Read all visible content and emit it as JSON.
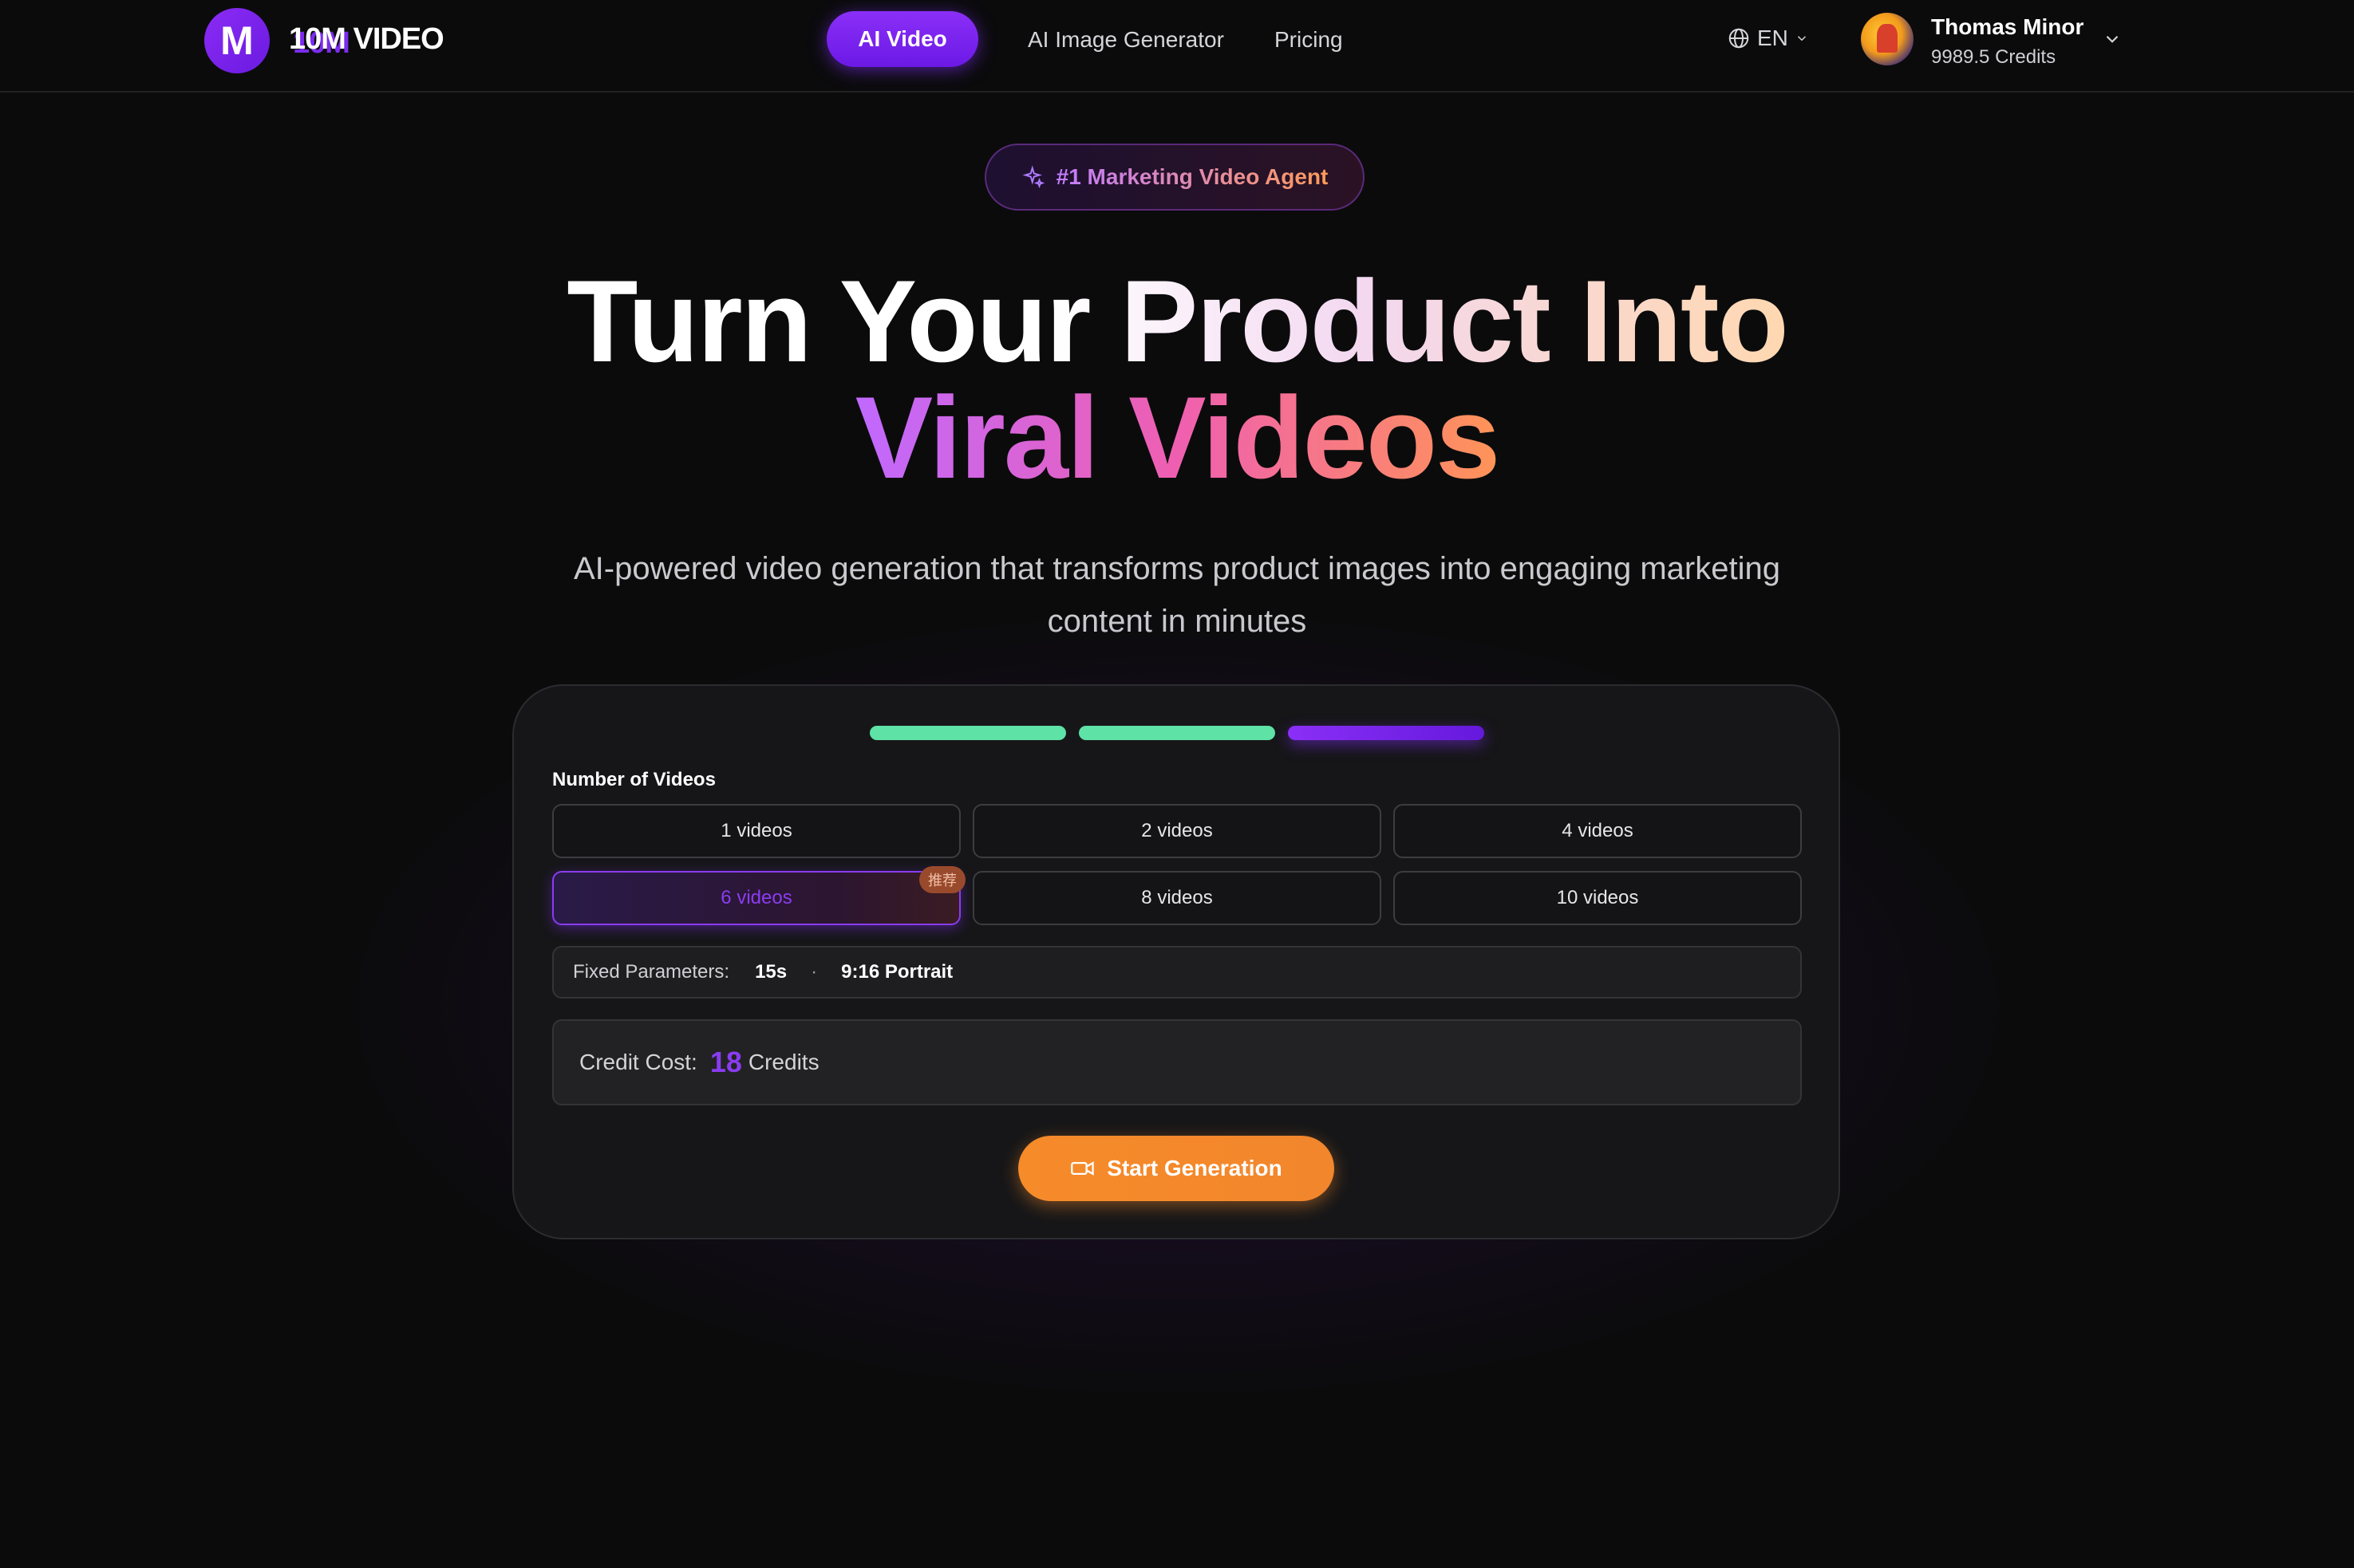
{
  "header": {
    "logo_letter": "M",
    "logo_text_accent": "10M",
    "logo_text_main": " VIDEO",
    "nav": {
      "ai_video": "AI Video",
      "ai_image_generator": "AI Image Generator",
      "pricing": "Pricing"
    },
    "language": "EN",
    "user": {
      "name": "Thomas Minor",
      "credits": "9989.5 Credits"
    }
  },
  "hero": {
    "badge": "#1 Marketing Video Agent",
    "title_line1": "Turn Your Product Into",
    "title_line2": "Viral Videos",
    "subtitle": "AI-powered video generation that transforms product images into engaging marketing content in minutes"
  },
  "card": {
    "steps": [
      {
        "state": "done"
      },
      {
        "state": "done"
      },
      {
        "state": "active"
      }
    ],
    "number_label": "Number of Videos",
    "options": [
      {
        "label": "1 videos",
        "selected": false
      },
      {
        "label": "2 videos",
        "selected": false
      },
      {
        "label": "4 videos",
        "selected": false
      },
      {
        "label": "6 videos",
        "selected": true,
        "badge": "推荐"
      },
      {
        "label": "8 videos",
        "selected": false
      },
      {
        "label": "10 videos",
        "selected": false
      }
    ],
    "fixed_params": {
      "label": "Fixed Parameters:",
      "duration": "15s",
      "separator": "·",
      "aspect": "9:16 Portrait"
    },
    "credit_cost": {
      "label": "Credit Cost:",
      "amount": "18",
      "unit": "Credits"
    },
    "start_button": "Start Generation"
  },
  "colors": {
    "accent_purple": "#8a2ff7",
    "step_done": "#5ee2a6",
    "start_orange": "#f68b2a"
  },
  "icons": {
    "language": "globe-icon",
    "badge": "sparkles-icon",
    "start": "video-camera-icon"
  }
}
